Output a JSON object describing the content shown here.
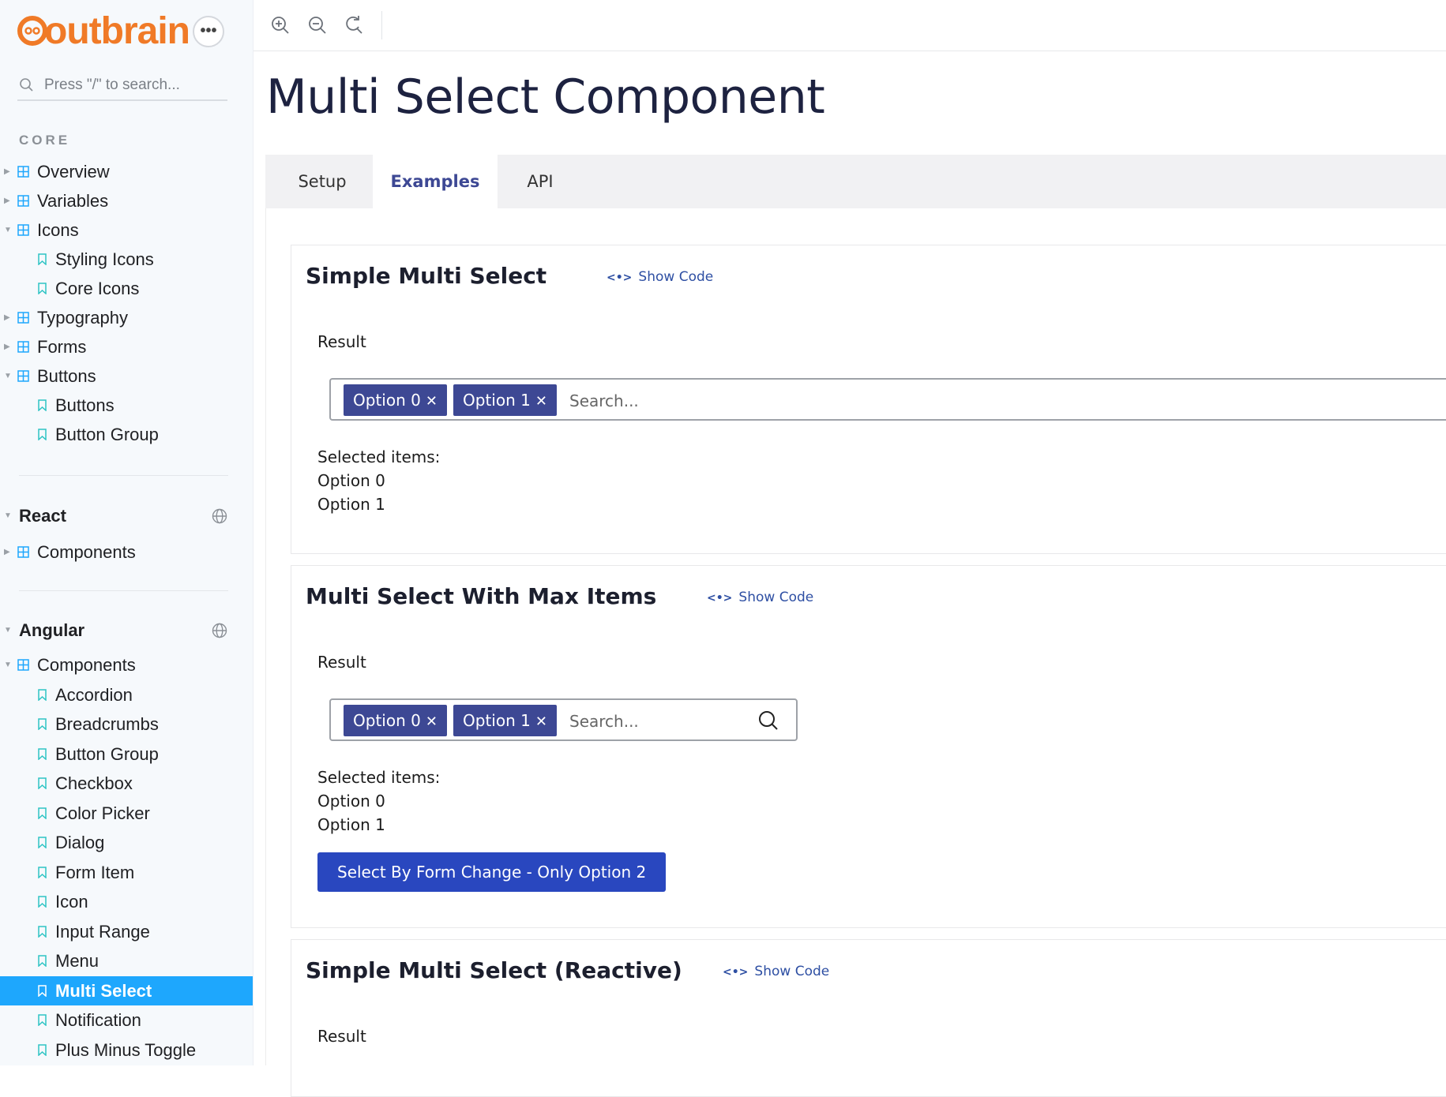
{
  "sidebar": {
    "brand": "outbrain",
    "more_label": "•••",
    "search_placeholder": "Press \"/\" to search...",
    "section_core": "CORE",
    "core_items": [
      {
        "label": "Overview"
      },
      {
        "label": "Variables"
      },
      {
        "label": "Icons"
      },
      {
        "label": "Styling Icons"
      },
      {
        "label": "Core Icons"
      },
      {
        "label": "Typography"
      },
      {
        "label": "Forms"
      },
      {
        "label": "Buttons"
      },
      {
        "label": "Buttons"
      },
      {
        "label": "Button Group"
      }
    ],
    "react": {
      "title": "React",
      "items": [
        {
          "label": "Components"
        }
      ]
    },
    "angular": {
      "title": "Angular",
      "items": [
        {
          "label": "Components"
        },
        {
          "label": "Accordion"
        },
        {
          "label": "Breadcrumbs"
        },
        {
          "label": "Button Group"
        },
        {
          "label": "Checkbox"
        },
        {
          "label": "Color Picker"
        },
        {
          "label": "Dialog"
        },
        {
          "label": "Form Item"
        },
        {
          "label": "Icon"
        },
        {
          "label": "Input Range"
        },
        {
          "label": "Menu"
        },
        {
          "label": "Multi Select"
        },
        {
          "label": "Notification"
        },
        {
          "label": "Plus Minus Toggle"
        }
      ],
      "active_item": "Multi Select"
    },
    "accent_color": "#1ea7fd"
  },
  "toolbar": {
    "buttons": [
      {
        "icon": "zoom-in-icon"
      },
      {
        "icon": "zoom-out-icon"
      },
      {
        "icon": "reset-zoom-icon"
      }
    ]
  },
  "main": {
    "title": "Multi Select Component",
    "tabs": [
      {
        "label": "Setup"
      },
      {
        "label": "Examples"
      },
      {
        "label": "API"
      }
    ],
    "active_tab": "Examples",
    "examples": [
      {
        "title": "Simple Multi Select",
        "show_code": "Show Code",
        "result_label": "Result",
        "chips": [
          "Option 0",
          "Option 1"
        ],
        "search_placeholder": "Search...",
        "selected_label": "Selected items:",
        "selected": [
          "Option 0",
          "Option 1"
        ]
      },
      {
        "title": "Multi Select With Max Items",
        "show_code": "Show Code",
        "result_label": "Result",
        "chips": [
          "Option 0",
          "Option 1"
        ],
        "search_placeholder": "Search...",
        "selected_label": "Selected items:",
        "selected": [
          "Option 0",
          "Option 1"
        ],
        "button_label": "Select By Form Change - Only Option 2"
      },
      {
        "title": "Simple Multi Select (Reactive)",
        "show_code": "Show Code",
        "result_label": "Result"
      }
    ],
    "chip_color": "#3d4894",
    "button_color": "#2947bf",
    "brand_color": "#f07a27"
  }
}
